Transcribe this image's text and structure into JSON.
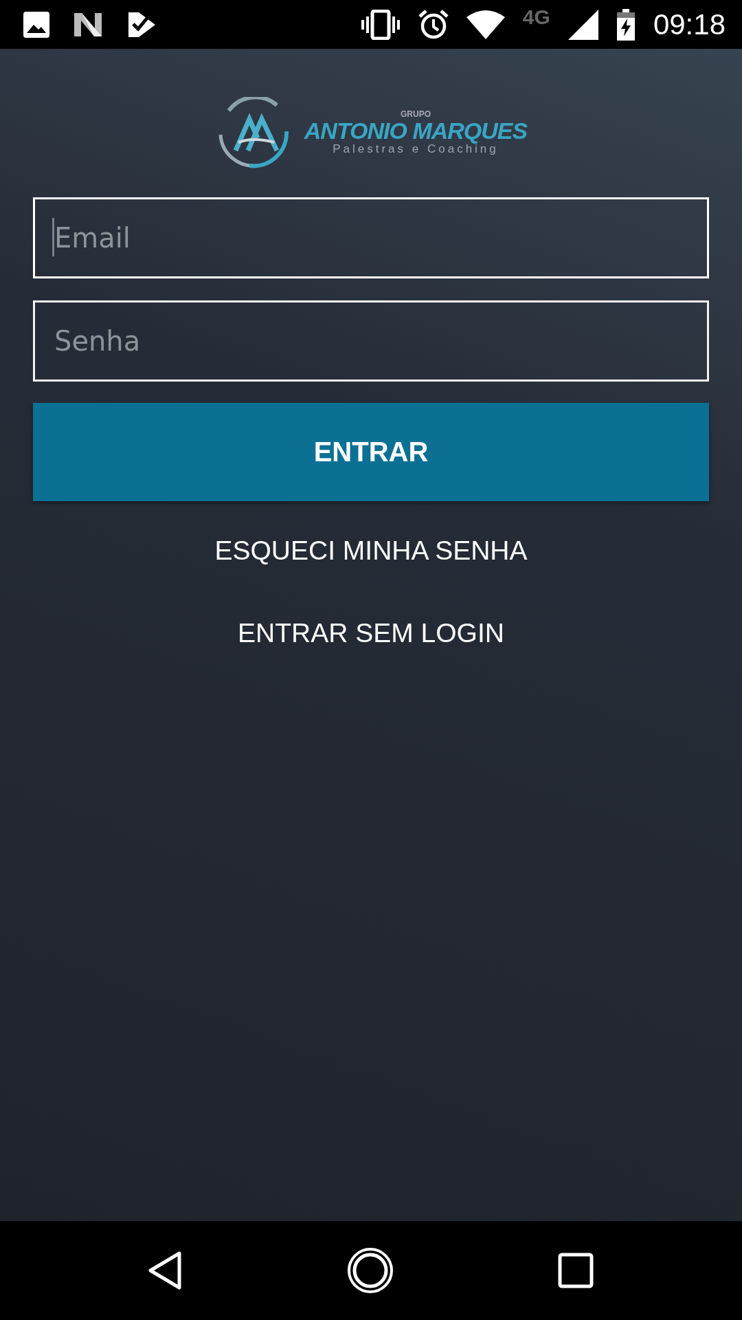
{
  "status_bar": {
    "network": "4G",
    "time": "09:18"
  },
  "logo": {
    "group": "GRUPO",
    "name": "ANTONIO MARQUES",
    "tagline": "Palestras e Coaching"
  },
  "fields": [
    {
      "placeholder": "Email",
      "focused": true
    },
    {
      "placeholder": "Senha",
      "focused": false
    }
  ],
  "primary_button": "ENTRAR",
  "links": [
    "ESQUECI MINHA SENHA",
    "ENTRAR SEM LOGIN"
  ]
}
